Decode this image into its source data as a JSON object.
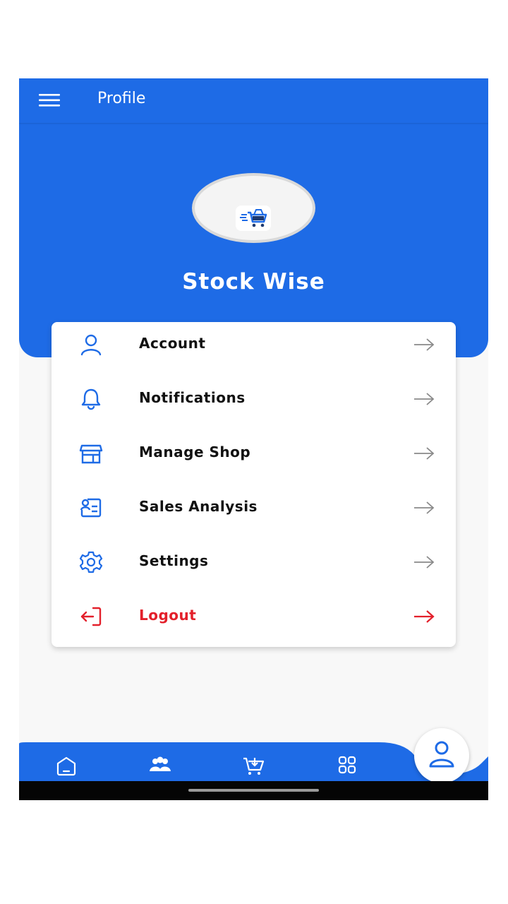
{
  "appbar": {
    "title": "Profile",
    "menu_icon": "hamburger-menu-icon"
  },
  "profile": {
    "name": "Stock Wise",
    "logo_icon": "shopping-cart-logo-icon"
  },
  "menu": [
    {
      "label": "Account",
      "icon": "user-icon",
      "color": "#1e6be6"
    },
    {
      "label": "Notifications",
      "icon": "bell-icon",
      "color": "#1e6be6"
    },
    {
      "label": "Manage Shop",
      "icon": "shop-icon",
      "color": "#1e6be6"
    },
    {
      "label": "Sales Analysis",
      "icon": "sales-report-icon",
      "color": "#1e6be6"
    },
    {
      "label": "Settings",
      "icon": "gear-icon",
      "color": "#1e6be6"
    },
    {
      "label": "Logout",
      "icon": "logout-icon",
      "color": "#e3202b"
    }
  ],
  "bottom_nav": [
    {
      "icon": "home-icon",
      "active": false
    },
    {
      "icon": "users-icon",
      "active": false
    },
    {
      "icon": "cart-icon",
      "active": false
    },
    {
      "icon": "grid-icon",
      "active": false
    },
    {
      "icon": "profile-icon",
      "active": true
    }
  ],
  "colors": {
    "primary": "#1e6be6",
    "danger": "#e3202b",
    "background": "#f8f8f8",
    "text": "#111111"
  }
}
